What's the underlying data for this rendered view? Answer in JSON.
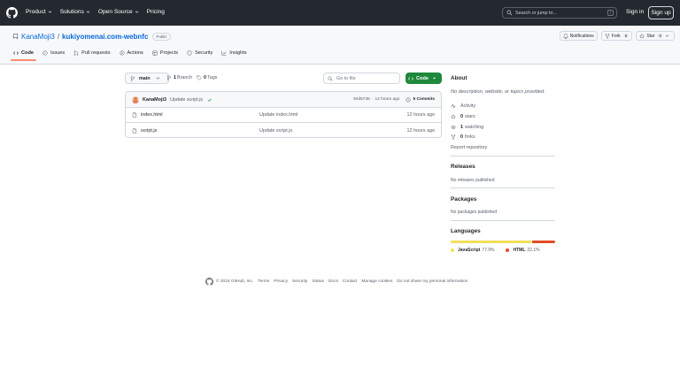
{
  "header": {
    "nav": [
      "Product",
      "Solutions",
      "Open Source",
      "Pricing"
    ],
    "search_placeholder": "Search or jump to...",
    "search_key": "/",
    "sign_in": "Sign in",
    "sign_up": "Sign up"
  },
  "repo": {
    "owner": "KanaMoji3",
    "separator": "/",
    "name": "kukiyomenai.com-webnfc",
    "visibility": "Public",
    "actions": {
      "notifications": "Notifications",
      "fork": "Fork",
      "fork_count": "0",
      "star": "Star",
      "star_count": "0"
    },
    "tabs": [
      "Code",
      "Issues",
      "Pull requests",
      "Actions",
      "Projects",
      "Security",
      "Insights"
    ]
  },
  "toolbar": {
    "branch": "main",
    "branch_count": "1",
    "branch_label": "Branch",
    "tag_count": "0",
    "tag_label": "Tags",
    "go_to_file": "Go to file",
    "code_button": "Code"
  },
  "commit": {
    "author": "KanaMoji3",
    "message": "Update script.js",
    "hash": "94d5736",
    "dot": "·",
    "time": "12 hours ago",
    "commits_count": "5",
    "commits_label": "Commits"
  },
  "files": [
    {
      "name": "index.html",
      "message": "Update index.html",
      "time": "12 hours ago"
    },
    {
      "name": "script.js",
      "message": "Update script.js",
      "time": "12 hours ago"
    }
  ],
  "sidebar": {
    "about_title": "About",
    "about_desc": "No description, website, or topics provided.",
    "activity": "Activity",
    "stars_count": "0",
    "stars_label": "stars",
    "watching_count": "1",
    "watching_label": "watching",
    "forks_count": "0",
    "forks_label": "forks",
    "report": "Report repository",
    "releases_title": "Releases",
    "releases_text": "No releases published",
    "packages_title": "Packages",
    "packages_text": "No packages published",
    "languages_title": "Languages",
    "languages": [
      {
        "name": "JavaScript",
        "percent": "77.9%",
        "fraction": 0.779,
        "color": "#f1e05a"
      },
      {
        "name": "HTML",
        "percent": "22.1%",
        "fraction": 0.221,
        "color": "#e34c26"
      }
    ]
  },
  "footer": {
    "copyright": "© 2024 GitHub, Inc.",
    "links": [
      "Terms",
      "Privacy",
      "Security",
      "Status",
      "Docs",
      "Contact",
      "Manage cookies",
      "Do not share my personal information"
    ]
  }
}
